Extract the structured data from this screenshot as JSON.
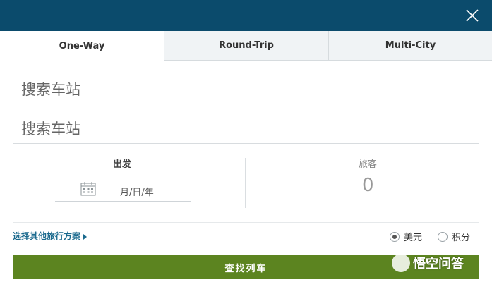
{
  "tabs": [
    {
      "label": "One-Way",
      "active": true
    },
    {
      "label": "Round-Trip",
      "active": false
    },
    {
      "label": "Multi-City",
      "active": false
    }
  ],
  "stations": {
    "from_placeholder": "搜索车站",
    "to_placeholder": "搜索车站"
  },
  "depart": {
    "label": "出发",
    "date_placeholder": "月/日/年"
  },
  "passengers": {
    "label": "旅客",
    "count": "0"
  },
  "options": {
    "other_options_label": "选择其他旅行方案",
    "currency_usd": "美元",
    "currency_points": "积分",
    "selected": "美元"
  },
  "search_button_label": "查找列车",
  "watermark_text": "悟空问答",
  "colors": {
    "header": "#0b4b6c",
    "button": "#5c8420",
    "link": "#1b6a8e"
  },
  "icons": [
    "close-icon",
    "calendar-icon",
    "caret-right-icon"
  ]
}
